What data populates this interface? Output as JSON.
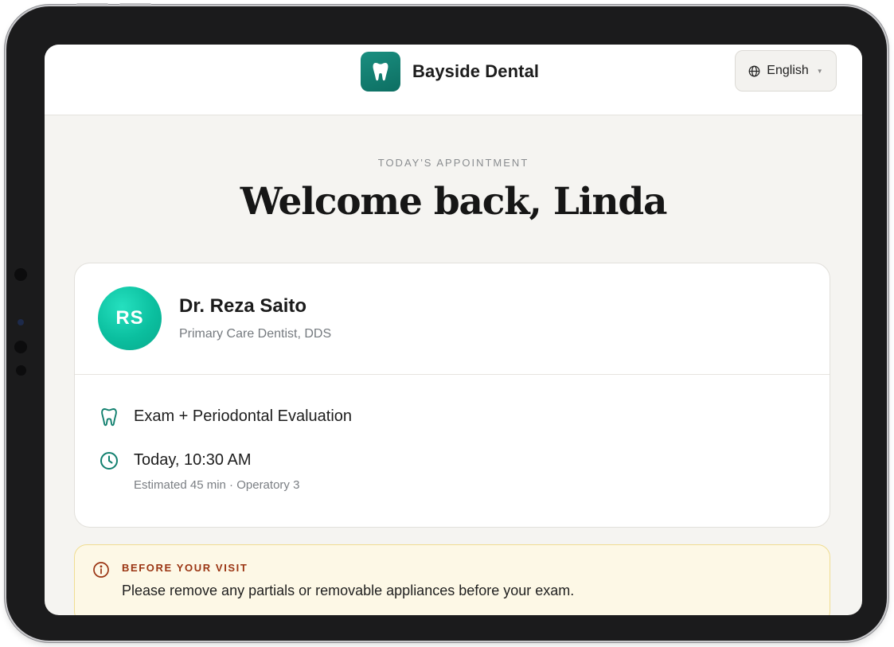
{
  "header": {
    "brand_name": "Bayside Dental",
    "brand_color": "#12806f",
    "logo_icon": "tooth-icon",
    "language_label": "English",
    "language_icon": "globe-icon"
  },
  "hero": {
    "eyebrow": "TODAY'S APPOINTMENT",
    "title": "Welcome back, Linda"
  },
  "appointment": {
    "provider": {
      "initials": "RS",
      "name": "Dr. Reza Saito",
      "role": "Primary Care Dentist, DDS"
    },
    "service": {
      "icon": "tooth-icon",
      "label": "Exam + Periodontal Evaluation"
    },
    "time": {
      "icon": "clock-icon",
      "label": "Today, 10:30 AM",
      "details": "Estimated 45 min · Operatory 3"
    }
  },
  "notice": {
    "icon": "info-icon",
    "title": "BEFORE YOUR VISIT",
    "text": "Please remove any partials or removable appliances before your exam.",
    "accent_color": "#9a3412"
  }
}
